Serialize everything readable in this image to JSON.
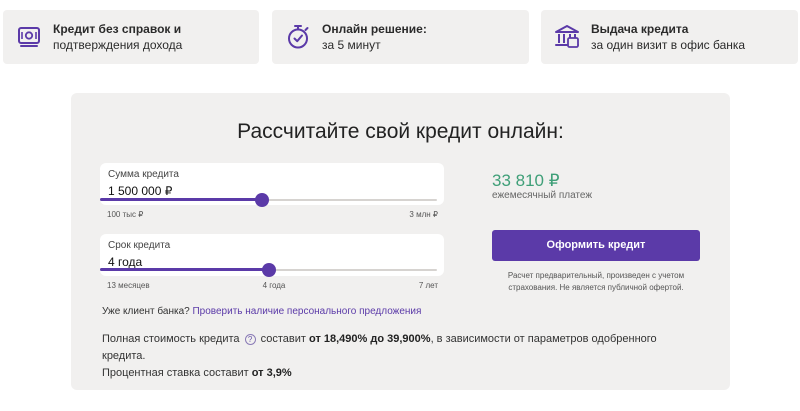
{
  "features": [
    {
      "line1": "Кредит без справок и",
      "line2": "подтверждения дохода",
      "icon": "document-money-icon"
    },
    {
      "line1": "Онлайн решение:",
      "line2": "за 5 минут",
      "icon": "stopwatch-icon"
    },
    {
      "line1": "Выдача кредита",
      "line2": "за один визит в офис банка",
      "icon": "bank-building-icon"
    }
  ],
  "calculator": {
    "title": "Рассчитайте свой кредит онлайн:",
    "sum": {
      "label": "Сумма кредита",
      "value": "1 500 000 ₽",
      "min_label": "100 тыс ₽",
      "max_label": "3 млн ₽",
      "level": 0.48
    },
    "term": {
      "label": "Срок кредита",
      "value": "4 года",
      "min_label": "13 месяцев",
      "mid_label": "4 года",
      "max_label": "7 лет",
      "level": 0.5
    },
    "client_prefix": "Уже клиент банка?",
    "client_link": "Проверить наличие персонального предложения",
    "cost_part1": "Полная стоимость кредита",
    "cost_part2": "составит",
    "cost_range": "от 18,490% до 39,900%",
    "cost_part3": ", в зависимости от параметров одобренного кредита.",
    "rate_prefix": "Процентная ставка составит",
    "rate_value": "от 3,9%",
    "payment_amount": "33 810 ₽",
    "payment_label": "ежемесячный платеж",
    "apply_button": "Оформить кредит",
    "note": "Расчет предварительный, произведен с учетом страхования. Не является публичной офертой."
  },
  "colors": {
    "accent": "#5b3aa8",
    "payment": "#3f9f78",
    "panel": "#f1f0ef"
  }
}
